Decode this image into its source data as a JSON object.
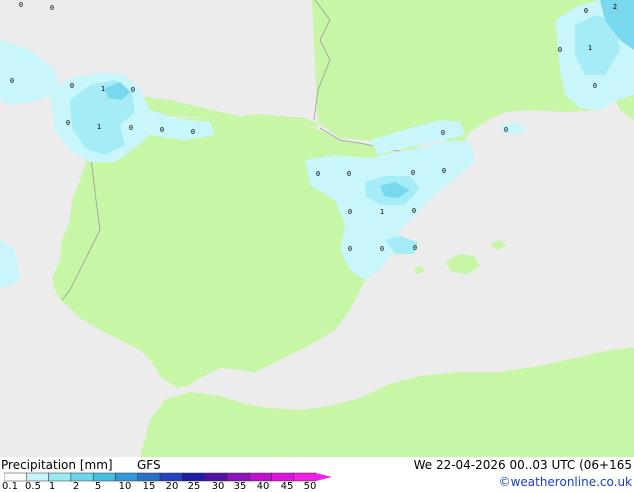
{
  "footer": {
    "title": "Precipitation [mm]",
    "model": "GFS",
    "datetime": "We 22-04-2026 00..03 UTC (06+165",
    "credit": "©weatheronline.co.uk"
  },
  "legend": {
    "ticks": [
      "0.1",
      "0.5",
      "1",
      "2",
      "5",
      "10",
      "15",
      "20",
      "25",
      "30",
      "35",
      "40",
      "45",
      "50"
    ],
    "colors": [
      "#fcfcfc",
      "#c6f4f8",
      "#9ae8f2",
      "#6ed6ec",
      "#44bfe4",
      "#3199d8",
      "#2a6fcc",
      "#2344be",
      "#1c1ea8",
      "#520fa8",
      "#8a10c0",
      "#c10ed0",
      "#dd14dc",
      "#f220e8"
    ]
  },
  "map": {
    "colors": {
      "sea": "#ececec",
      "land": "#c6f6a6",
      "border": "#9a9a9a",
      "precip_light": "#c8f6fa",
      "precip_mid": "#a6ecf6",
      "precip_strong": "#78d8ee"
    },
    "labels": [
      "0",
      "0",
      "0",
      "1",
      "0",
      "1",
      "0",
      "0",
      "0",
      "0",
      "0",
      "0",
      "0",
      "0",
      "0",
      "1",
      "0",
      "0",
      "0",
      "0",
      "0",
      "0",
      "0",
      "2",
      "0",
      "1",
      "0",
      "0"
    ]
  }
}
